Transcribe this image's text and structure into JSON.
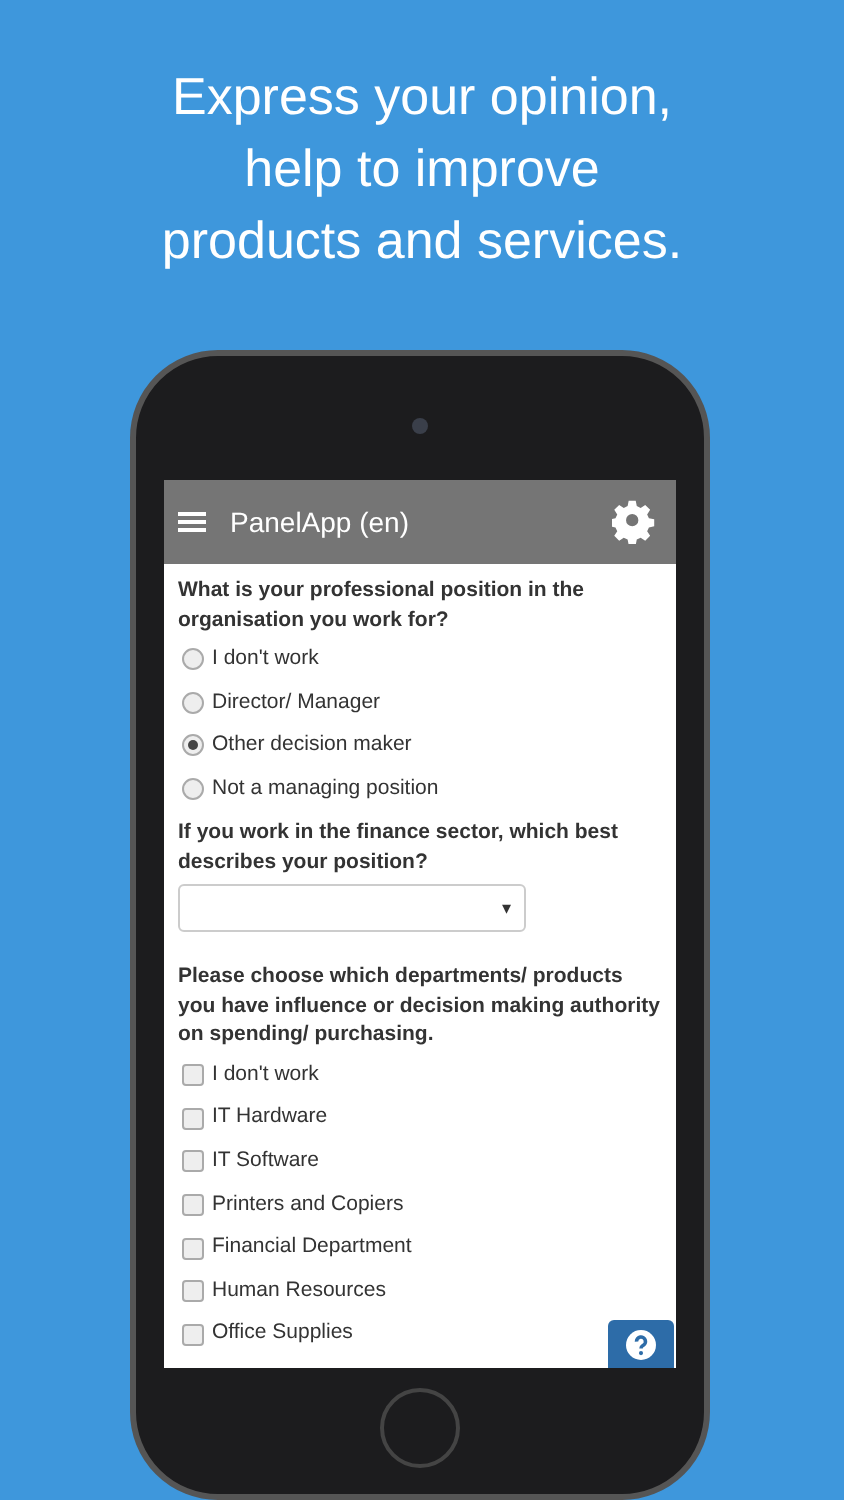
{
  "headline": "Express your opinion,\nhelp to improve\nproducts and services.",
  "app_bar": {
    "title": "PanelApp (en)"
  },
  "questions": [
    {
      "kind": "radio",
      "text": "What is your professional position in the organisation you work for?",
      "options": [
        {
          "label": "I don't work",
          "selected": false
        },
        {
          "label": "Director/ Manager",
          "selected": false
        },
        {
          "label": "Other decision maker",
          "selected": true
        },
        {
          "label": "Not a managing position",
          "selected": false
        }
      ]
    },
    {
      "kind": "select",
      "text": "If you work in the finance sector, which best describes your position?",
      "caret": "▾"
    },
    {
      "kind": "checkbox",
      "text": "Please choose which departments/ products you have influence or decision making authority on spending/ purchasing.",
      "options": [
        {
          "label": "I don't work",
          "checked": false
        },
        {
          "label": "IT Hardware",
          "checked": false
        },
        {
          "label": "IT Software",
          "checked": false
        },
        {
          "label": "Printers and Copiers",
          "checked": false
        },
        {
          "label": "Financial Department",
          "checked": false
        },
        {
          "label": "Human Resources",
          "checked": false
        },
        {
          "label": "Office Supplies",
          "checked": false
        }
      ]
    }
  ]
}
